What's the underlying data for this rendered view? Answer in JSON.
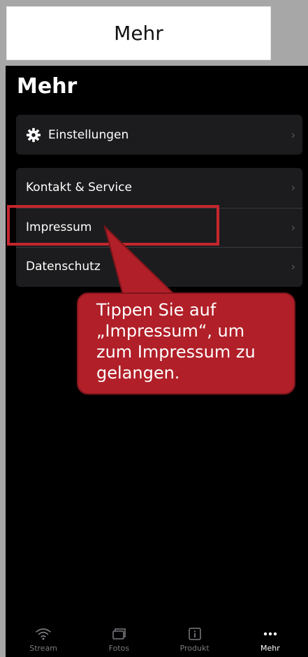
{
  "doc": {
    "title": "Mehr"
  },
  "screen": {
    "title": "Mehr"
  },
  "menu": {
    "settings": {
      "label": "Einstellungen",
      "icon": "gear-icon"
    },
    "items": [
      {
        "label": "Kontakt & Service"
      },
      {
        "label": "Impressum"
      },
      {
        "label": "Datenschutz"
      }
    ],
    "chevron": "›"
  },
  "callout": {
    "text": "Tippen Sie auf\n„Impressum“, um\nzum Impressum zu\ngelangen."
  },
  "tabs": [
    {
      "label": "Stream",
      "icon": "wifi-icon",
      "active": false
    },
    {
      "label": "Fotos",
      "icon": "photos-icon",
      "active": false
    },
    {
      "label": "Produkt",
      "icon": "info-icon",
      "active": false
    },
    {
      "label": "Mehr",
      "icon": "more-icon",
      "active": true
    }
  ],
  "colors": {
    "accent": "#b11f28",
    "background": "#000000",
    "card": "#1c1c1e",
    "inactive": "#7b7b80"
  }
}
